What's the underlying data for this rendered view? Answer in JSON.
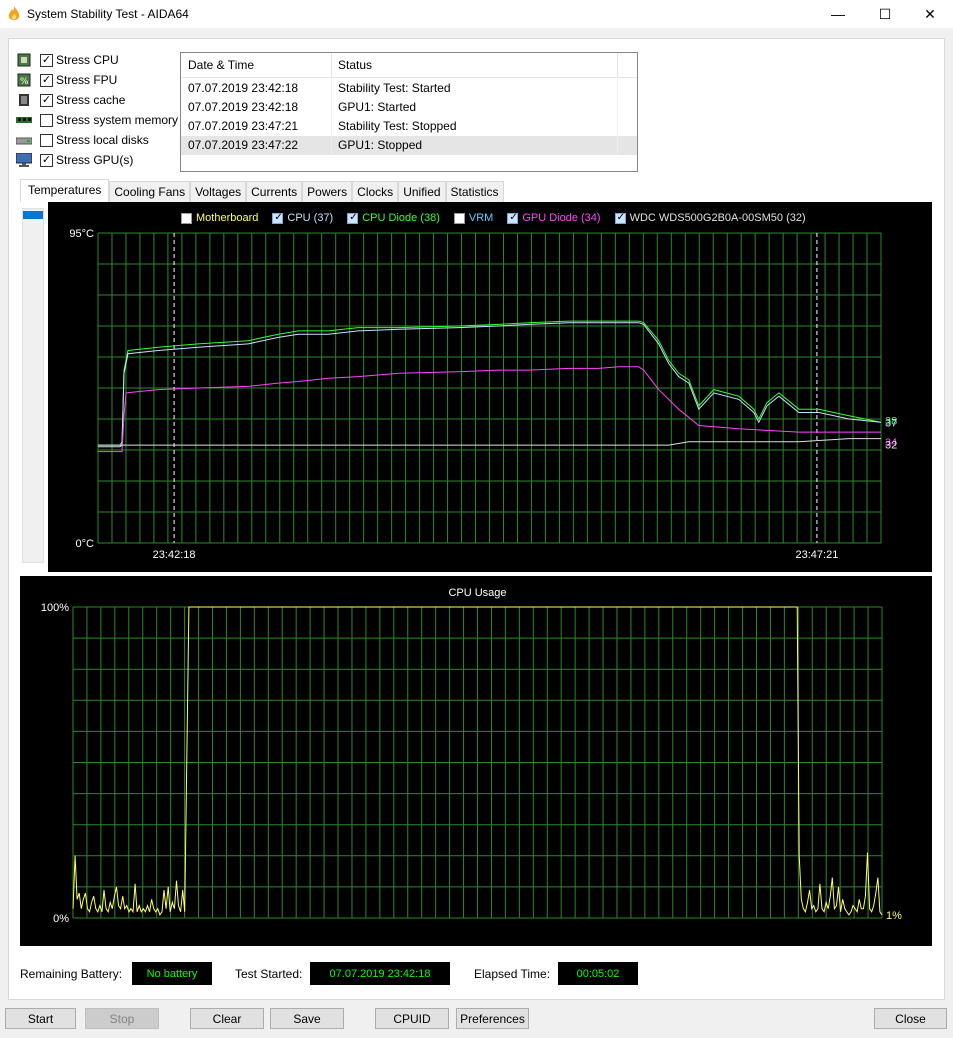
{
  "window": {
    "title": "System Stability Test - AIDA64",
    "minimize": "—",
    "maximize": "☐",
    "close": "✕"
  },
  "stress_options": [
    {
      "label": "Stress CPU",
      "checked": true,
      "icon": "cpu-chip-icon"
    },
    {
      "label": "Stress FPU",
      "checked": true,
      "icon": "fpu-chip-icon"
    },
    {
      "label": "Stress cache",
      "checked": true,
      "icon": "cache-chip-icon"
    },
    {
      "label": "Stress system memory",
      "checked": false,
      "icon": "memory-module-icon"
    },
    {
      "label": "Stress local disks",
      "checked": false,
      "icon": "disk-drive-icon"
    },
    {
      "label": "Stress GPU(s)",
      "checked": true,
      "icon": "monitor-icon"
    }
  ],
  "log": {
    "headers": [
      "Date & Time",
      "Status"
    ],
    "rows": [
      {
        "time": "07.07.2019 23:42:18",
        "status": "Stability Test: Started"
      },
      {
        "time": "07.07.2019 23:42:18",
        "status": "GPU1: Started"
      },
      {
        "time": "07.07.2019 23:47:21",
        "status": "Stability Test: Stopped"
      },
      {
        "time": "07.07.2019 23:47:22",
        "status": "GPU1: Stopped"
      }
    ]
  },
  "tabs": [
    "Temperatures",
    "Cooling Fans",
    "Voltages",
    "Currents",
    "Powers",
    "Clocks",
    "Unified",
    "Statistics"
  ],
  "active_tab": "Temperatures",
  "temperature_legend": [
    {
      "label": "Motherboard",
      "checked": false,
      "color": "#ffff66"
    },
    {
      "label": "CPU (37)",
      "checked": true,
      "color": "#c8e0ff"
    },
    {
      "label": "CPU Diode (38)",
      "checked": true,
      "color": "#33ff33"
    },
    {
      "label": "VRM",
      "checked": false,
      "color": "#66ccff"
    },
    {
      "label": "GPU Diode (34)",
      "checked": true,
      "color": "#ff44ff"
    },
    {
      "label": "WDC  WDS500G2B0A-00SM50 (32)",
      "checked": true,
      "color": "#e0e0e0"
    }
  ],
  "chart_data": [
    {
      "type": "line",
      "title": "",
      "ylabel_top": "95°C",
      "ylabel_bottom": "0°C",
      "ylim": [
        0,
        95
      ],
      "x_ticks": [
        "23:42:18",
        "23:47:21"
      ],
      "markers": [
        "23:42:18",
        "23:47:21"
      ],
      "grid": true,
      "series": [
        {
          "name": "CPU Diode (38)",
          "color": "#33ff33",
          "end_label": "38",
          "x": [
            0,
            22,
            24,
            26,
            28,
            30,
            60,
            100,
            150,
            180,
            200,
            230,
            260,
            300,
            360,
            400,
            430,
            470,
            500,
            520,
            540,
            545,
            560,
            570,
            580,
            590,
            600,
            615,
            640,
            655,
            660,
            668,
            680,
            700,
            720,
            750,
            782
          ],
          "y": [
            30,
            30,
            31,
            53,
            56,
            59,
            60,
            61,
            62,
            64,
            65,
            65,
            66,
            66,
            66.5,
            67,
            67.5,
            68,
            68,
            68,
            68,
            67.5,
            62,
            56,
            52,
            50,
            42,
            47,
            45,
            41,
            38,
            43,
            46,
            41,
            41,
            39,
            37
          ]
        },
        {
          "name": "CPU (37)",
          "color": "#c8e0ff",
          "end_label": "37",
          "x": [
            0,
            22,
            24,
            26,
            28,
            30,
            60,
            100,
            150,
            180,
            200,
            230,
            260,
            300,
            360,
            400,
            430,
            470,
            500,
            520,
            540,
            545,
            560,
            570,
            580,
            590,
            600,
            615,
            640,
            655,
            660,
            668,
            680,
            700,
            720,
            750,
            782
          ],
          "y": [
            29.5,
            29.5,
            30,
            52,
            55,
            58,
            59,
            60,
            61,
            63,
            64,
            64,
            65,
            65.5,
            66,
            66.5,
            67,
            67.5,
            67.5,
            67.5,
            67.5,
            67,
            61,
            55,
            51,
            49,
            41,
            46,
            44,
            40,
            37,
            42,
            45,
            40,
            40,
            38,
            37
          ]
        },
        {
          "name": "GPU Diode (34)",
          "color": "#ff44ff",
          "end_label": "34",
          "x": [
            0,
            22,
            24,
            26,
            28,
            60,
            100,
            150,
            180,
            200,
            230,
            260,
            300,
            360,
            400,
            430,
            470,
            500,
            520,
            540,
            545,
            560,
            580,
            600,
            640,
            700,
            782
          ],
          "y": [
            28,
            28,
            28,
            39,
            46,
            47,
            47.5,
            48,
            49,
            49.5,
            50.5,
            51,
            52,
            52.5,
            53,
            53,
            53.5,
            53.5,
            54,
            54,
            53,
            47,
            41,
            36,
            35,
            34,
            34
          ]
        },
        {
          "name": "WDC  WDS500G2B0A-00SM50 (32)",
          "color": "#e0e0e0",
          "end_label": "32",
          "x": [
            0,
            150,
            300,
            400,
            570,
            590,
            600,
            700,
            750,
            782
          ],
          "y": [
            30,
            30,
            30,
            30,
            30,
            31,
            31,
            31,
            32,
            32
          ]
        }
      ]
    },
    {
      "type": "line",
      "title": "CPU Usage",
      "ylabel_top": "100%",
      "ylabel_bottom": "0%",
      "ylim": [
        0,
        100
      ],
      "grid": true,
      "series": [
        {
          "name": "CPU Usage",
          "color": "#ffff66",
          "end_label": "1%",
          "x": [
            0,
            2,
            4,
            6,
            8,
            10,
            12,
            14,
            16,
            18,
            20,
            22,
            24,
            26,
            28,
            30,
            32,
            34,
            36,
            38,
            40,
            42,
            44,
            46,
            48,
            50,
            52,
            54,
            56,
            58,
            60,
            62,
            64,
            66,
            68,
            70,
            72,
            74,
            76,
            78,
            80,
            82,
            84,
            86,
            88,
            90,
            92,
            94,
            96,
            98,
            100,
            102,
            104,
            106,
            108,
            112,
            116,
            700,
            702,
            704,
            706,
            708,
            710,
            712,
            714,
            716,
            718,
            720,
            722,
            724,
            726,
            728,
            730,
            732,
            734,
            736,
            738,
            740,
            742,
            744,
            746,
            748,
            750,
            752,
            754,
            756,
            758,
            760,
            762,
            764,
            766,
            768,
            770,
            772,
            774,
            776,
            778,
            780,
            782
          ],
          "y": [
            3,
            20,
            6,
            8,
            3,
            6,
            8,
            3,
            2,
            5,
            7,
            3,
            2,
            4,
            2,
            9,
            3,
            2,
            5,
            3,
            7,
            10,
            4,
            3,
            7,
            3,
            4,
            2,
            3,
            2,
            11,
            2,
            4,
            2,
            3,
            2,
            4,
            2,
            6,
            3,
            2,
            3,
            1,
            2,
            9,
            3,
            10,
            2,
            5,
            3,
            12,
            4,
            2,
            9,
            2,
            100,
            100,
            100,
            20,
            6,
            3,
            2,
            5,
            9,
            3,
            4,
            2,
            3,
            11,
            3,
            2,
            5,
            3,
            7,
            13,
            3,
            4,
            10,
            2,
            6,
            3,
            2,
            1,
            2,
            4,
            3,
            2,
            6,
            3,
            3,
            7,
            21,
            3,
            2,
            4,
            8,
            13,
            2,
            1
          ]
        }
      ]
    }
  ],
  "status": {
    "remaining_battery_label": "Remaining Battery:",
    "remaining_battery_value": "No battery",
    "test_started_label": "Test Started:",
    "test_started_value": "07.07.2019 23:42:18",
    "elapsed_label": "Elapsed Time:",
    "elapsed_value": "00:05:02"
  },
  "buttons": {
    "start": "Start",
    "stop": "Stop",
    "clear": "Clear",
    "save": "Save",
    "cpuid": "CPUID",
    "preferences": "Preferences",
    "close": "Close"
  }
}
